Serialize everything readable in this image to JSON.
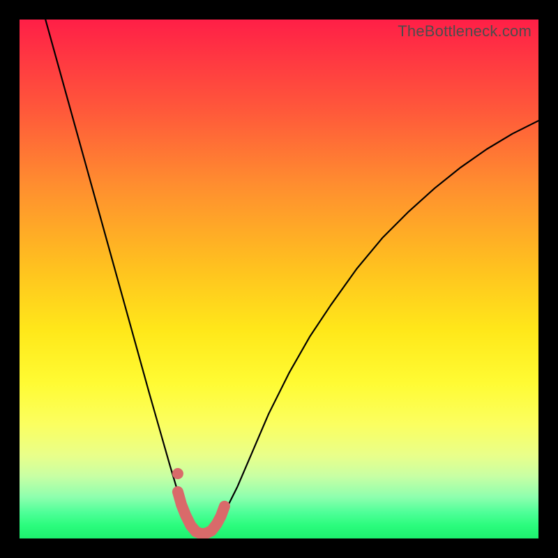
{
  "watermark": "TheBottleneck.com",
  "colors": {
    "background": "#000000",
    "curve": "#000000",
    "marker": "#d96a6a",
    "gradient_top": "#ff1f47",
    "gradient_mid": "#ffe81a",
    "gradient_bottom": "#1df06e"
  },
  "chart_data": {
    "type": "line",
    "title": "",
    "xlabel": "",
    "ylabel": "",
    "xlim": [
      0,
      100
    ],
    "ylim": [
      0,
      100
    ],
    "grid": false,
    "series": [
      {
        "name": "bottleneck-curve",
        "x": [
          5,
          7.5,
          10,
          12.5,
          15,
          17.5,
          20,
          22.5,
          25,
          27,
          29,
          30.5,
          32,
          33,
          34,
          35,
          36,
          37,
          38,
          40,
          42,
          45,
          48,
          52,
          56,
          60,
          65,
          70,
          75,
          80,
          85,
          90,
          95,
          100
        ],
        "values": [
          100,
          91,
          82,
          73,
          64,
          55,
          46,
          37,
          28,
          21,
          14,
          9,
          5,
          3,
          1.5,
          1,
          1,
          1.5,
          3,
          6,
          10,
          17,
          24,
          32,
          39,
          45,
          52,
          58,
          63,
          67.5,
          71.5,
          75,
          78,
          80.5
        ]
      }
    ],
    "annotations": [
      {
        "name": "optimal-band",
        "type": "marker-stroke",
        "x": [
          30.5,
          31.2,
          32,
          33,
          34,
          35,
          36,
          37,
          38,
          38.8,
          39.5
        ],
        "values": [
          9,
          6.5,
          4.5,
          2.5,
          1.3,
          0.9,
          1.0,
          1.5,
          2.8,
          4.3,
          6.2
        ]
      },
      {
        "name": "optimal-dot",
        "type": "marker-point",
        "x": 30.5,
        "value": 12.5
      }
    ]
  }
}
